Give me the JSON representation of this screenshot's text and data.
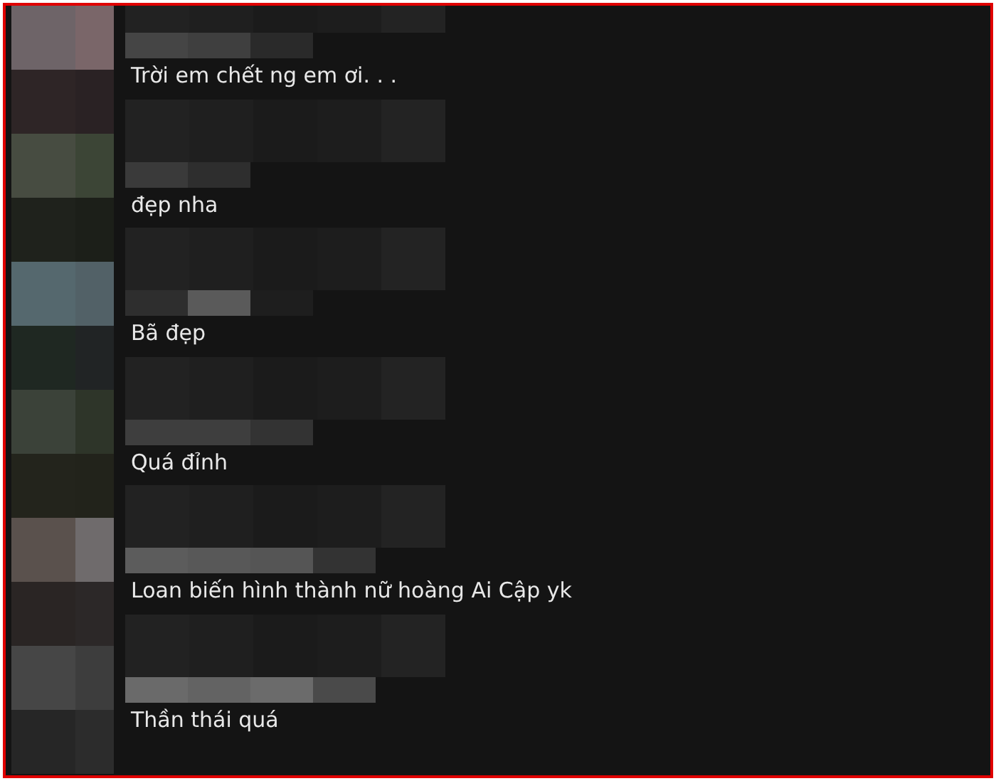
{
  "comments": [
    {
      "text": "Trời em chết ng em ơi. . ."
    },
    {
      "text": "đẹp nha"
    },
    {
      "text": "Bã đẹp"
    },
    {
      "text": "Quá đỉnh"
    },
    {
      "text": "Loan biến hình thành nữ hoàng Ai Cập yk"
    },
    {
      "text": "Thần thái quá"
    }
  ]
}
